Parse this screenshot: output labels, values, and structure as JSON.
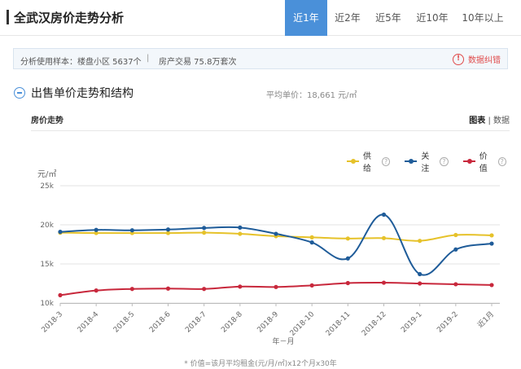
{
  "header": {
    "title": "全武汉房价走势分析",
    "tabs": [
      "近1年",
      "近2年",
      "近5年",
      "近10年",
      "10年以上"
    ],
    "active_tab": 0
  },
  "info": {
    "sample": "分析使用样本：楼盘小区 5637个",
    "separator": "|",
    "trade": "房产交易 75.8万套次",
    "error_label": "数据纠错"
  },
  "section": {
    "title": "出售单价走势和结构",
    "avg_price": "平均单价：18,661 元/㎡"
  },
  "panel": {
    "label": "房价走势",
    "view_chart": "图表",
    "view_sep": "|",
    "view_data": "数据"
  },
  "footnote": "* 价值=该月平均租金(元/月/㎡)x12个月x30年",
  "colors": {
    "accent": "#4a90d9",
    "supply": "#e6c22a",
    "attention": "#1f5c99",
    "value": "#c8283c",
    "error": "#e04b4b"
  },
  "chart_data": {
    "type": "line",
    "ylabel": "元/㎡",
    "xlabel": "年－月",
    "ylim": [
      10000,
      25000
    ],
    "yticks": [
      10000,
      15000,
      20000,
      25000
    ],
    "ytick_labels": [
      "10k",
      "15k",
      "20k",
      "25k"
    ],
    "categories": [
      "2018-3",
      "2018-4",
      "2018-5",
      "2018-6",
      "2018-7",
      "2018-8",
      "2018-9",
      "2018-10",
      "2018-11",
      "2018-12",
      "2019-1",
      "2019-2",
      "近1月"
    ],
    "grid": true,
    "legend_position": "top-right",
    "series": [
      {
        "name": "供给",
        "color": "#e6c22a",
        "values": [
          19000,
          18950,
          18950,
          18950,
          19000,
          18850,
          18550,
          18400,
          18250,
          18300,
          17950,
          18700,
          18650
        ]
      },
      {
        "name": "关注",
        "color": "#1f5c99",
        "values": [
          19100,
          19350,
          19300,
          19400,
          19600,
          19650,
          18850,
          17750,
          15700,
          21300,
          13700,
          16850,
          17600
        ]
      },
      {
        "name": "价值",
        "color": "#c8283c",
        "values": [
          11000,
          11600,
          11800,
          11850,
          11800,
          12100,
          12050,
          12250,
          12550,
          12600,
          12500,
          12400,
          12300
        ]
      }
    ]
  }
}
